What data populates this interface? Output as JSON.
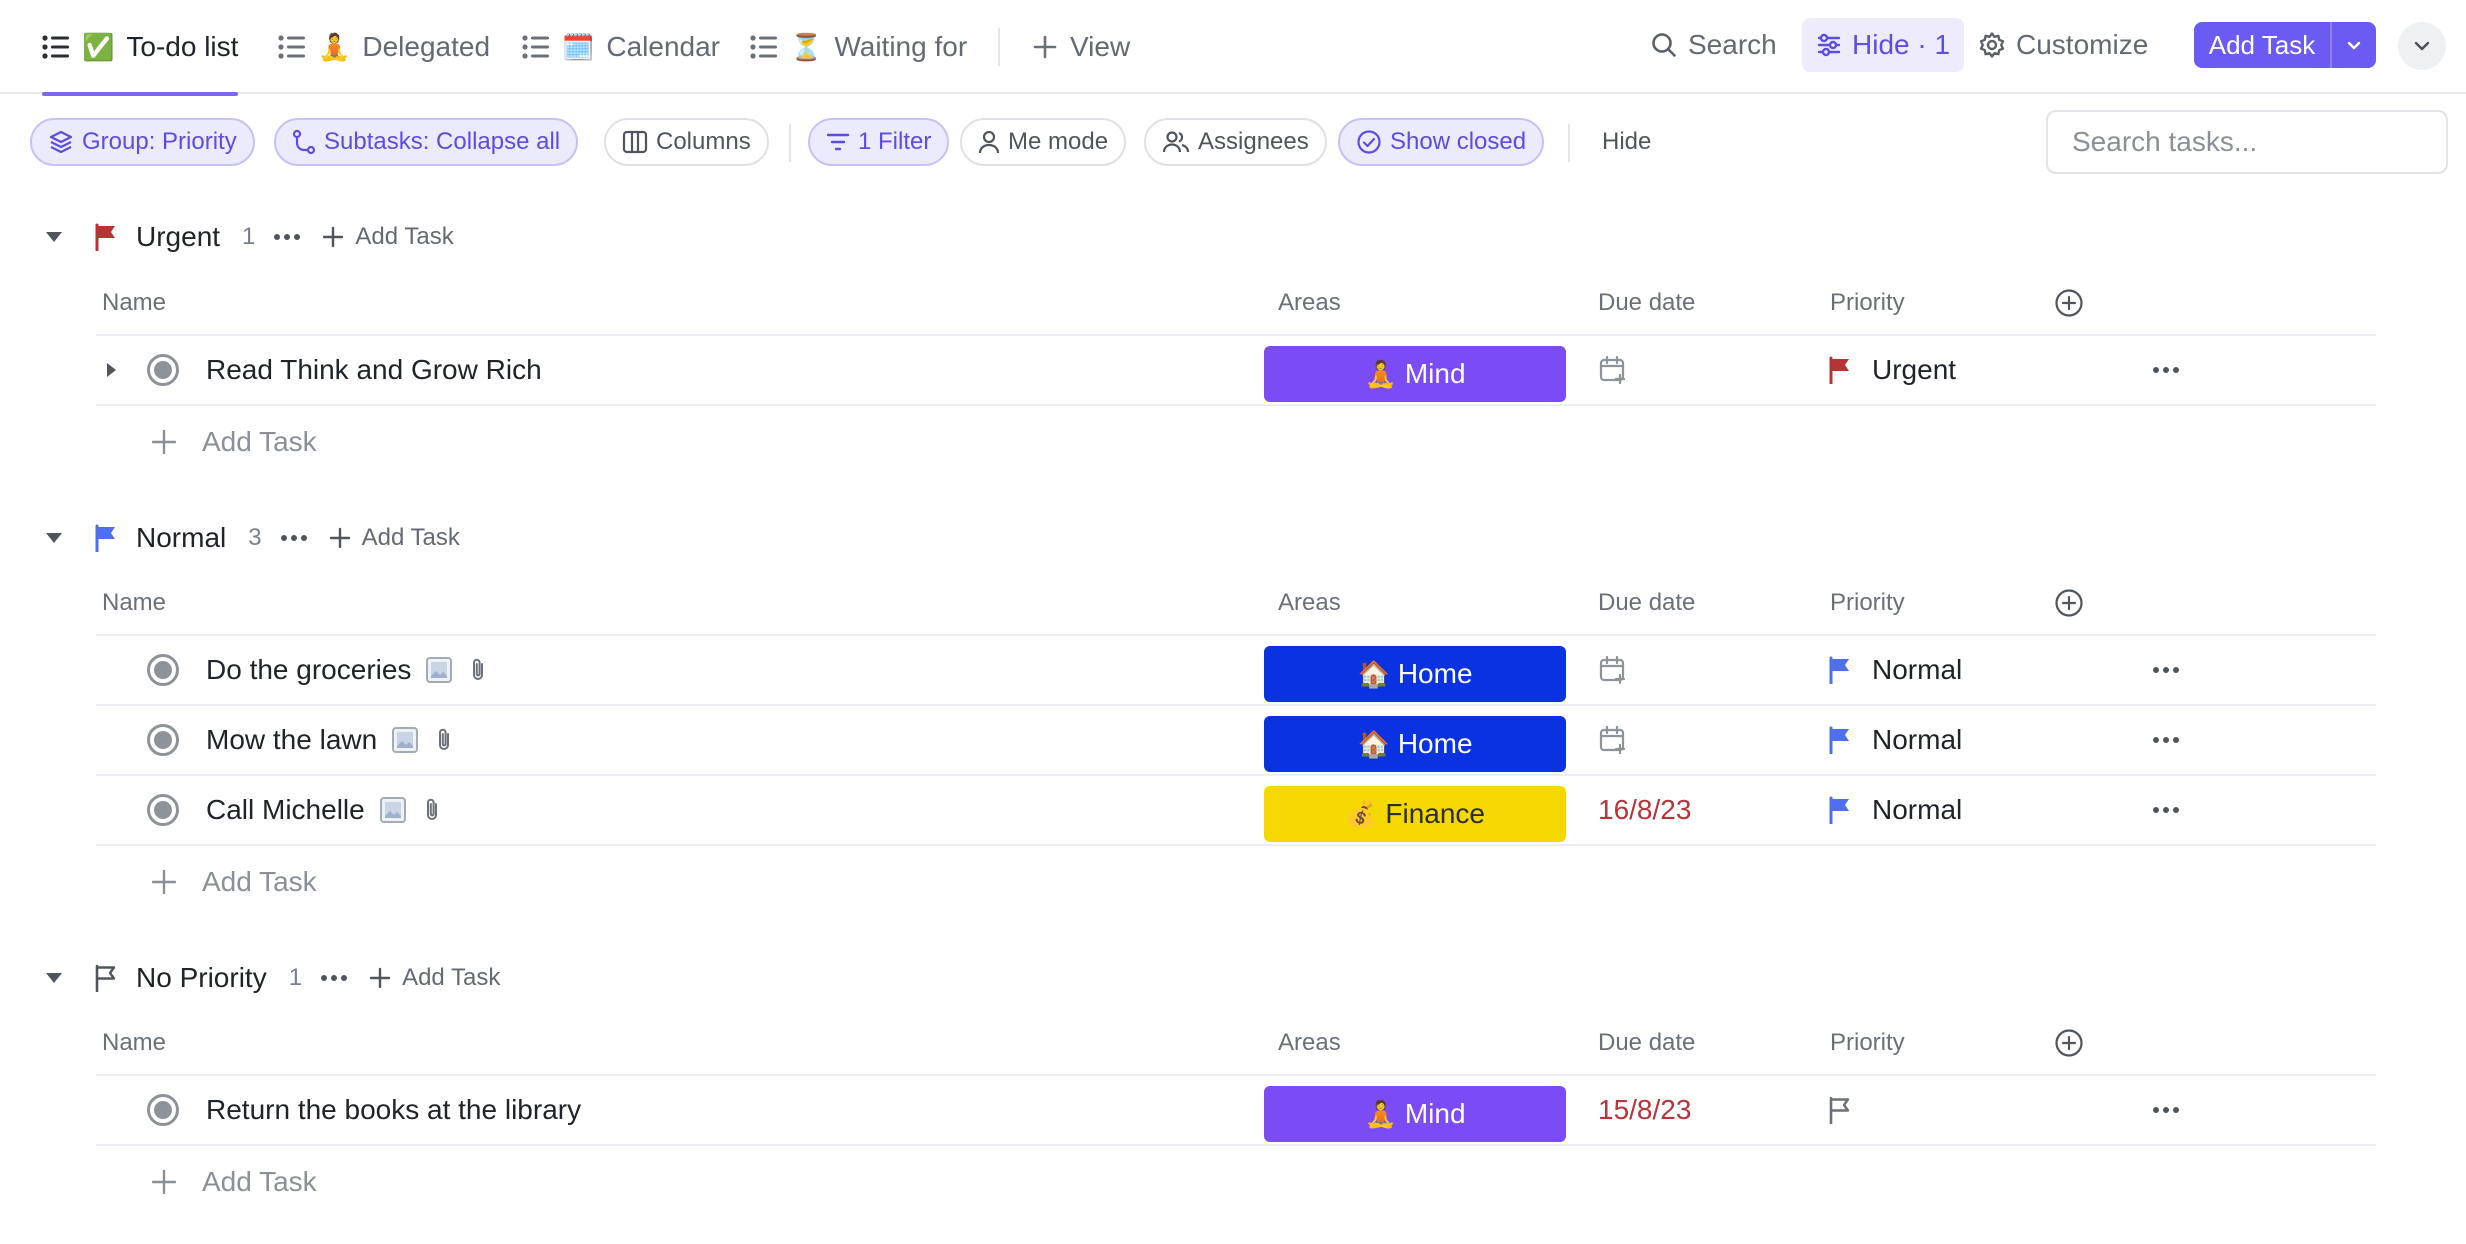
{
  "colors": {
    "accent": "#7b68ee",
    "primary_button": "#6a5cf2",
    "urgent_flag": "#b53535",
    "normal_flag": "#4f6ef0",
    "due_overdue": "#b8333a",
    "area_mind": "#7b4cf6",
    "area_home": "#0a32e0",
    "area_finance": "#f5d800"
  },
  "tabs": [
    {
      "icon": "list-icon",
      "emoji": "✅",
      "label": "To-do list",
      "active": true
    },
    {
      "icon": "list-icon",
      "emoji": "🧘",
      "label": "Delegated",
      "active": false
    },
    {
      "icon": "list-icon",
      "emoji": "🗓️",
      "label": "Calendar",
      "active": false
    },
    {
      "icon": "list-icon",
      "emoji": "⏳",
      "label": "Waiting for",
      "active": false
    }
  ],
  "toolbar": {
    "view_label": "View",
    "search_label": "Search",
    "hide_label": "Hide · 1",
    "customize_label": "Customize",
    "add_task_label": "Add Task"
  },
  "filters": {
    "group": "Group: Priority",
    "subtasks": "Subtasks: Collapse all",
    "columns": "Columns",
    "filter": "1 Filter",
    "me_mode": "Me mode",
    "assignees": "Assignees",
    "show_closed": "Show closed",
    "hide": "Hide",
    "search_placeholder": "Search tasks..."
  },
  "columns": {
    "name": "Name",
    "areas": "Areas",
    "due_date": "Due date",
    "priority": "Priority"
  },
  "add_task_label": "Add Task",
  "groups": [
    {
      "name": "Urgent",
      "count": "1",
      "flag": "urgent",
      "tasks": [
        {
          "name": "Read Think and Grow Rich",
          "has_subtasks": true,
          "area": "Mind",
          "area_emoji": "🧘",
          "due": "",
          "priority": "Urgent",
          "attachments": false
        }
      ]
    },
    {
      "name": "Normal",
      "count": "3",
      "flag": "normal",
      "tasks": [
        {
          "name": "Do the groceries",
          "has_subtasks": false,
          "area": "Home",
          "area_emoji": "🏠",
          "due": "",
          "priority": "Normal",
          "attachments": true
        },
        {
          "name": "Mow the lawn",
          "has_subtasks": false,
          "area": "Home",
          "area_emoji": "🏠",
          "due": "",
          "priority": "Normal",
          "attachments": true
        },
        {
          "name": "Call Michelle",
          "has_subtasks": false,
          "area": "Finance",
          "area_emoji": "💰",
          "due": "16/8/23",
          "priority": "Normal",
          "attachments": true
        }
      ]
    },
    {
      "name": "No Priority",
      "count": "1",
      "flag": "none",
      "tasks": [
        {
          "name": "Return the books at the library",
          "has_subtasks": false,
          "area": "Mind",
          "area_emoji": "🧘",
          "due": "15/8/23",
          "priority": "",
          "attachments": false
        }
      ]
    }
  ]
}
